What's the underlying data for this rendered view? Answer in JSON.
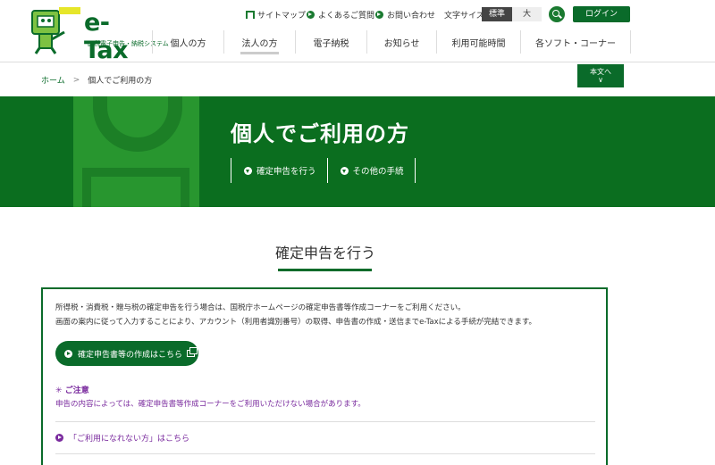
{
  "header": {
    "logo_text": "e-Tax",
    "logo_sub": "国税電子申告・納税システム",
    "util_links": [
      "サイトマップ",
      "よくあるご質問",
      "お問い合わせ"
    ],
    "font_size_label": "文字サイズ",
    "font_std": "標準",
    "font_big": "大",
    "login": "ログイン",
    "nav": [
      "個人の方",
      "法人の方",
      "電子納税",
      "お知らせ",
      "利用可能時間",
      "各ソフト・コーナー"
    ]
  },
  "breadcrumb": {
    "home": "ホーム",
    "current": "個人でご利用の方"
  },
  "skip_button": "本文へ",
  "banner": {
    "title": "個人でご利用の方",
    "links": [
      "確定申告を行う",
      "その他の手続"
    ]
  },
  "section": {
    "title": "確定申告を行う",
    "line1": "所得税・消費税・贈与税の確定申告を行う場合は、国税庁ホームページの確定申告書等作成コーナーをご利用ください。",
    "line2": "画面の案内に従って入力することにより、アカウント（利用者識別番号）の取得、申告書の作成・送信までe-Taxによる手続が完結できます。",
    "button": "確定申告書等の作成はこちら",
    "caution_title": "ご注意",
    "caution_text": "申告の内容によっては、確定申告書等作成コーナーをご利用いただけない場合があります。",
    "link": "「ご利用になれない方」はこちら"
  },
  "colors": {
    "brand_green": "#0a6b2a",
    "banner_green": "#0b6e1f",
    "caution_purple": "#7a2b9e"
  }
}
